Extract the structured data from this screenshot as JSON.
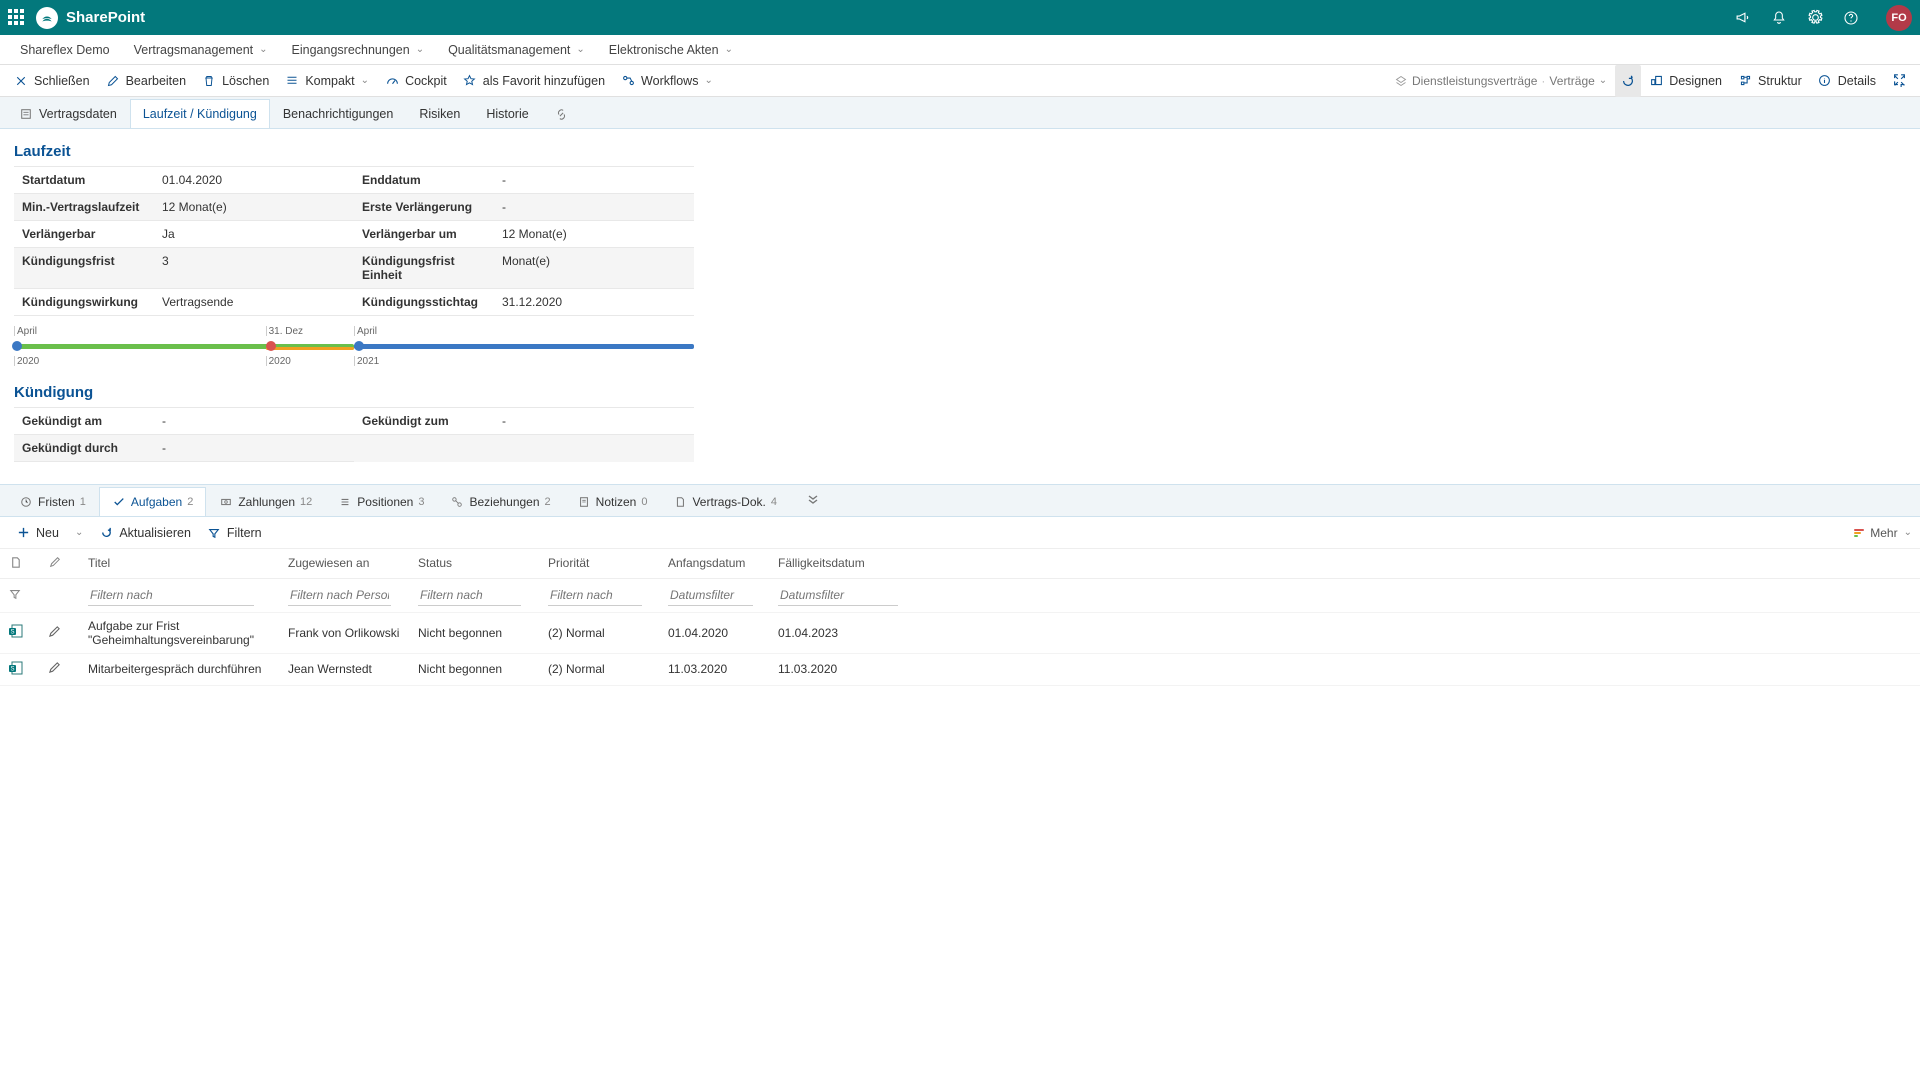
{
  "header": {
    "brand": "SharePoint",
    "avatar": "FO"
  },
  "nav": {
    "items": [
      "Shareflex Demo",
      "Vertragsmanagement",
      "Eingangsrechnungen",
      "Qualitätsmanagement",
      "Elektronische Akten"
    ]
  },
  "toolbar": {
    "close": "Schließen",
    "edit": "Bearbeiten",
    "delete": "Löschen",
    "compact": "Kompakt",
    "cockpit": "Cockpit",
    "favorite": "als Favorit hinzufügen",
    "workflows": "Workflows",
    "breadcrumb1": "Dienstleistungsverträge",
    "breadcrumb2": "Verträge",
    "design": "Designen",
    "structure": "Struktur",
    "details": "Details"
  },
  "tabs": {
    "t0": "Vertragsdaten",
    "t1": "Laufzeit / Kündigung",
    "t2": "Benachrichtigungen",
    "t3": "Risiken",
    "t4": "Historie"
  },
  "laufzeit": {
    "title": "Laufzeit",
    "f0l": "Startdatum",
    "f0v": "01.04.2020",
    "f1l": "Enddatum",
    "f1v": "-",
    "f2l": "Min.-Vertragslaufzeit",
    "f2v": "12  Monat(e)",
    "f3l": "Erste Verlängerung",
    "f3v": "-",
    "f4l": "Verlängerbar",
    "f4v": "Ja",
    "f5l": "Verlängerbar um",
    "f5v": "12  Monat(e)",
    "f6l": "Kündigungsfrist",
    "f6v": "3",
    "f7l": "Kündigungsfrist Einheit",
    "f7v": "Monat(e)",
    "f8l": "Kündigungswirkung",
    "f8v": "Vertragsende",
    "f9l": "Kündigungsstichtag",
    "f9v": "31.12.2020"
  },
  "timeline": {
    "l0": "April",
    "l1": "31. Dez",
    "l2": "April",
    "b0": "2020",
    "b1": "2020",
    "b2": "2021"
  },
  "kuendigung": {
    "title": "Kündigung",
    "f0l": "Gekündigt am",
    "f0v": "-",
    "f1l": "Gekündigt zum",
    "f1v": "-",
    "f2l": "Gekündigt durch",
    "f2v": "-"
  },
  "lowerTabs": {
    "t0": "Fristen",
    "c0": "1",
    "t1": "Aufgaben",
    "c1": "2",
    "t2": "Zahlungen",
    "c2": "12",
    "t3": "Positionen",
    "c3": "3",
    "t4": "Beziehungen",
    "c4": "2",
    "t5": "Notizen",
    "c5": "0",
    "t6": "Vertrags-Dok.",
    "c6": "4"
  },
  "subToolbar": {
    "neu": "Neu",
    "refresh": "Aktualisieren",
    "filter": "Filtern",
    "more": "Mehr"
  },
  "table": {
    "h0": "Titel",
    "h1": "Zugewiesen an",
    "h2": "Status",
    "h3": "Priorität",
    "h4": "Anfangsdatum",
    "h5": "Fälligkeitsdatum",
    "ph0": "Filtern nach",
    "ph1": "Filtern nach Person",
    "ph2": "Filtern nach",
    "ph3": "Filtern nach",
    "ph4": "Datumsfilter",
    "ph5": "Datumsfilter",
    "rows": [
      {
        "title": "Aufgabe zur Frist \"Geheimhaltungsvereinbarung\"",
        "assigned": "Frank von Orlikowski",
        "status": "Nicht begonnen",
        "prio": "(2) Normal",
        "start": "01.04.2020",
        "due": "01.04.2023"
      },
      {
        "title": "Mitarbeitergespräch durchführen",
        "assigned": "Jean Wernstedt",
        "status": "Nicht begonnen",
        "prio": "(2) Normal",
        "start": "11.03.2020",
        "due": "11.03.2020"
      }
    ]
  },
  "colors": {
    "accent": "#03787c",
    "link": "#0b5394"
  }
}
